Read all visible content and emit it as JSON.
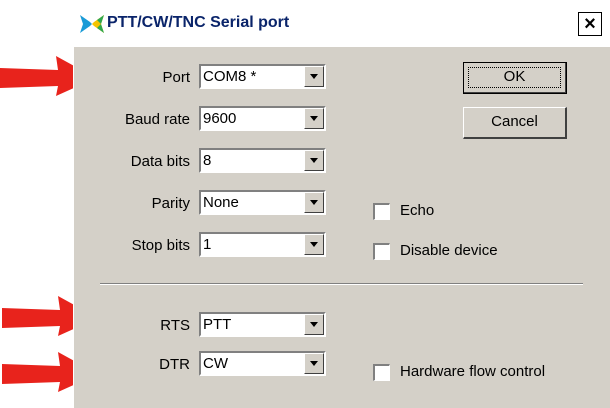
{
  "window": {
    "title": "PTT/CW/TNC Serial port",
    "close_glyph": "×"
  },
  "fields": {
    "port": {
      "label": "Port",
      "value": "COM8 *"
    },
    "baud_rate": {
      "label": "Baud rate",
      "value": "9600"
    },
    "data_bits": {
      "label": "Data bits",
      "value": "8"
    },
    "parity": {
      "label": "Parity",
      "value": "None"
    },
    "stop_bits": {
      "label": "Stop bits",
      "value": "1"
    },
    "rts": {
      "label": "RTS",
      "value": "PTT"
    },
    "dtr": {
      "label": "DTR",
      "value": "CW"
    }
  },
  "buttons": {
    "ok": "OK",
    "cancel": "Cancel"
  },
  "checkboxes": {
    "echo": {
      "label": "Echo",
      "checked": false
    },
    "disable_device": {
      "label": "Disable device",
      "checked": false
    },
    "hw_flow": {
      "label": "Hardware flow control",
      "checked": false
    }
  },
  "annotations": {
    "arrow_color": "#e8231c",
    "icons": [
      "butterfly-icon",
      "close-icon",
      "dropdown-arrow-icon",
      "red-arrow-icon"
    ]
  }
}
